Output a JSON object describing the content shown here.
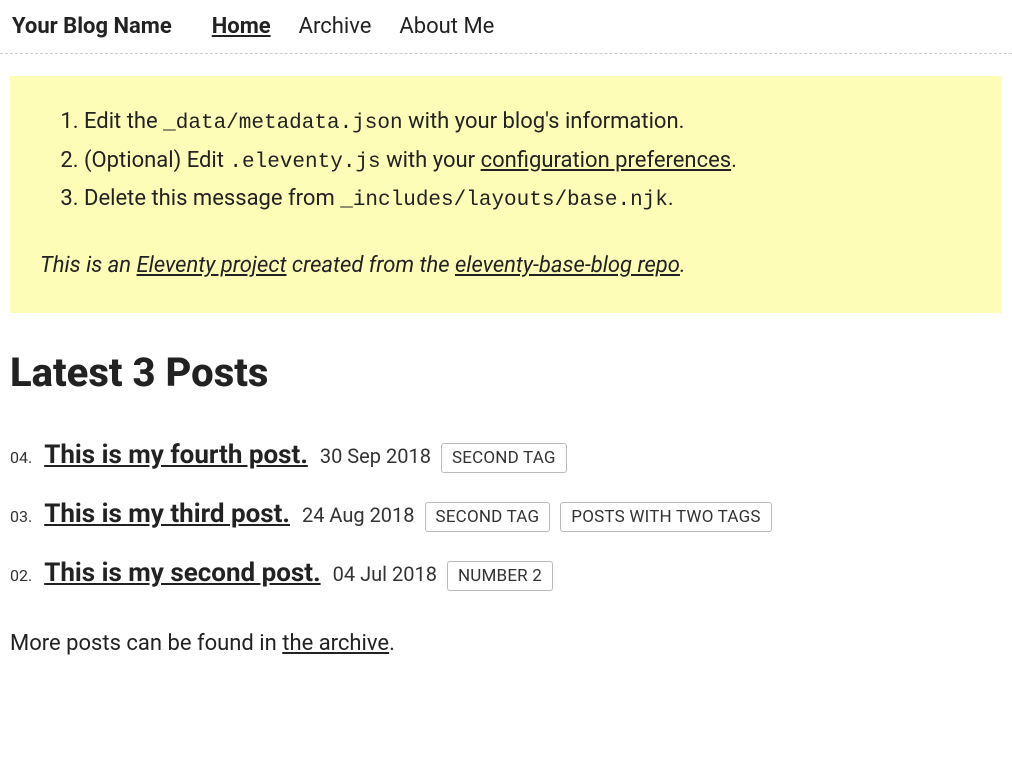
{
  "header": {
    "brand": "Your Blog Name",
    "nav": [
      {
        "label": "Home",
        "active": true
      },
      {
        "label": "Archive",
        "active": false
      },
      {
        "label": "About Me",
        "active": false
      }
    ]
  },
  "notice": {
    "item1_prefix": "Edit the ",
    "item1_code": "_data/metadata.json",
    "item1_suffix": " with your blog's information.",
    "item2_prefix": "(Optional) Edit ",
    "item2_code": ".eleventy.js",
    "item2_mid": " with your ",
    "item2_link": "configuration preferences",
    "item2_suffix": ".",
    "item3_prefix": "Delete this message from ",
    "item3_code": "_includes/layouts/base.njk",
    "item3_suffix": ".",
    "footer_prefix": "This is an ",
    "footer_link1": "Eleventy project",
    "footer_mid": " created from the ",
    "footer_link2": "eleventy-base-blog repo",
    "footer_suffix": "."
  },
  "section_title": "Latest 3 Posts",
  "posts": [
    {
      "num": "04.",
      "title": "This is my fourth post.",
      "date": "30 Sep 2018",
      "tags": [
        "SECOND TAG"
      ]
    },
    {
      "num": "03.",
      "title": "This is my third post.",
      "date": "24 Aug 2018",
      "tags": [
        "SECOND TAG",
        "POSTS WITH TWO TAGS"
      ]
    },
    {
      "num": "02.",
      "title": "This is my second post.",
      "date": "04 Jul 2018",
      "tags": [
        "NUMBER 2"
      ]
    }
  ],
  "more": {
    "prefix": "More posts can be found in ",
    "link": "the archive",
    "suffix": "."
  }
}
